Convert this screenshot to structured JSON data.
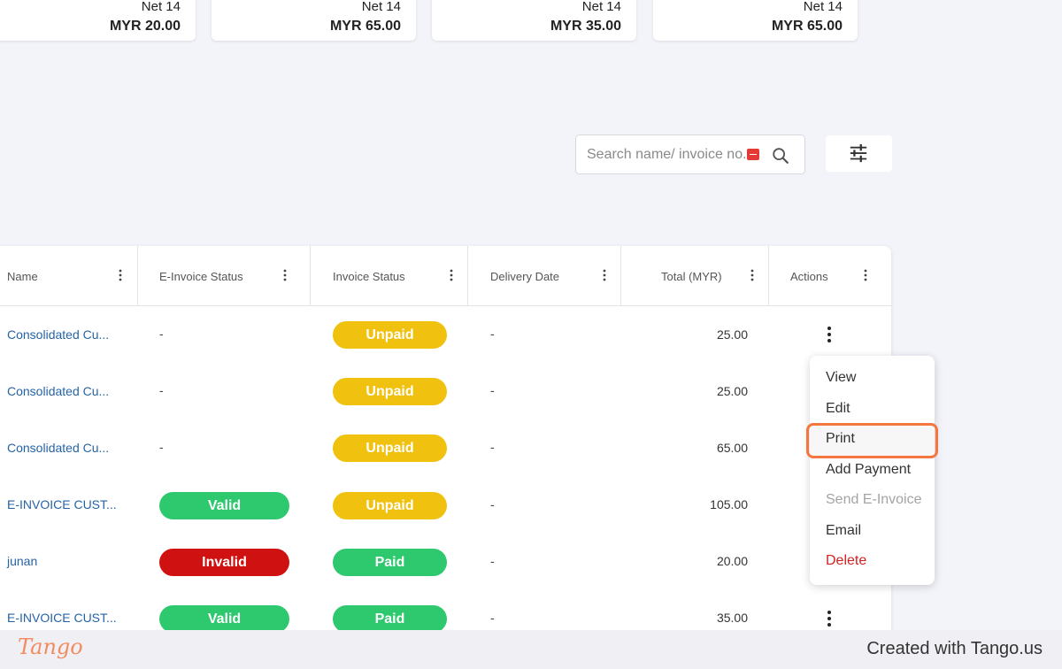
{
  "summary_cards": [
    {
      "term": "Net 14",
      "amount": "MYR 20.00"
    },
    {
      "term": "Net 14",
      "amount": "MYR 65.00"
    },
    {
      "term": "Net 14",
      "amount": "MYR 35.00"
    },
    {
      "term": "Net 14",
      "amount": "MYR 65.00"
    }
  ],
  "search": {
    "placeholder": "Search name/ invoice no."
  },
  "table": {
    "columns": {
      "name": "Name",
      "einvoice_status": "E-Invoice Status",
      "invoice_status": "Invoice Status",
      "delivery_date": "Delivery Date",
      "total": "Total (MYR)",
      "actions": "Actions"
    },
    "rows": [
      {
        "name": "Consolidated Cu...",
        "einvoice": "-",
        "status": "Unpaid",
        "delivery": "-",
        "total": "25.00"
      },
      {
        "name": "Consolidated Cu...",
        "einvoice": "-",
        "status": "Unpaid",
        "delivery": "-",
        "total": "25.00"
      },
      {
        "name": "Consolidated Cu...",
        "einvoice": "-",
        "status": "Unpaid",
        "delivery": "-",
        "total": "65.00"
      },
      {
        "name": "E-INVOICE CUST...",
        "einvoice": "Valid",
        "status": "Unpaid",
        "delivery": "-",
        "total": "105.00"
      },
      {
        "name": "junan",
        "einvoice": "Invalid",
        "status": "Paid",
        "delivery": "-",
        "total": "20.00"
      },
      {
        "name": "E-INVOICE CUST...",
        "einvoice": "Valid",
        "status": "Paid",
        "delivery": "-",
        "total": "35.00"
      }
    ]
  },
  "actions_menu": {
    "view": "View",
    "edit": "Edit",
    "print": "Print",
    "add_payment": "Add Payment",
    "send_einvoice": "Send E-Invoice",
    "email": "Email",
    "delete": "Delete"
  },
  "footer": {
    "logo": "Tango",
    "credit": "Created with Tango.us"
  },
  "colors": {
    "unpaid": "#f0c10f",
    "paid": "#2ec86f",
    "valid": "#2ec86f",
    "invalid": "#d01111",
    "link": "#2563a8",
    "highlight": "#f5773f",
    "danger": "#d32222"
  }
}
